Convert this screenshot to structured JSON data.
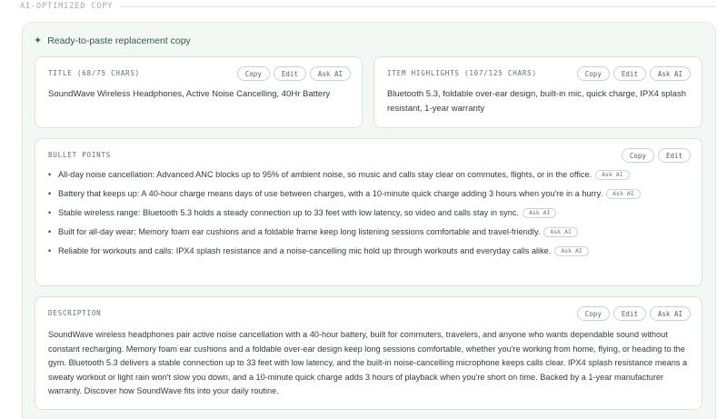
{
  "section": {
    "label": "AI-OPTIMIZED COPY"
  },
  "panel": {
    "title": "Ready-to-paste replacement copy",
    "sparkle_icon": "sparkle-icon"
  },
  "actions": {
    "copy": "Copy",
    "edit": "Edit",
    "ask_ai": "Ask AI"
  },
  "title_card": {
    "label": "TITLE (68/75 CHARS)",
    "text": "SoundWave Wireless Headphones, Active Noise Cancelling, 40Hr Battery"
  },
  "highlights_card": {
    "label": "ITEM HIGHLIGHTS (107/125 CHARS)",
    "text": "Bluetooth 5.3, foldable over-ear design, built-in mic, quick charge, IPX4 splash resistant, 1-year warranty"
  },
  "bullets_card": {
    "label": "BULLET POINTS",
    "items": [
      {
        "text": "All-day noise cancellation: Advanced ANC blocks up to 95% of ambient noise, so music and calls stay clear on commutes, flights, or in the office."
      },
      {
        "text": "Battery that keeps up: A 40-hour charge means days of use between charges, with a 10-minute quick charge adding 3 hours when you're in a hurry."
      },
      {
        "text": "Stable wireless range: Bluetooth 5.3 holds a steady connection up to 33 feet with low latency, so video and calls stay in sync."
      },
      {
        "text": "Built for all-day wear: Memory foam ear cushions and a foldable frame keep long listening sessions comfortable and travel-friendly."
      },
      {
        "text": "Reliable for workouts and calls: IPX4 splash resistance and a noise-cancelling mic hold up through workouts and everyday calls alike."
      }
    ]
  },
  "description_card": {
    "label": "DESCRIPTION",
    "text": "SoundWave wireless headphones pair active noise cancellation with a 40-hour battery, built for commuters, travelers, and anyone who wants dependable sound without constant recharging. Memory foam ear cushions and a foldable over-ear design keep long sessions comfortable, whether you're working from home, flying, or heading to the gym. Bluetooth 5.3 delivers a stable connection up to 33 feet with low latency, and the built-in noise-cancelling microphone keeps calls clear. IPX4 splash resistance means a sweaty workout or light rain won't slow you down, and a 10-minute quick charge adds 3 hours of playback when you're short on time. Backed by a 1-year manufacturer warranty. Discover how SoundWave fits into your daily routine."
  },
  "colors": {
    "accent": "#2e7a54",
    "panel_bg": "#f3f8f5",
    "card_border": "#d9e3dd"
  }
}
